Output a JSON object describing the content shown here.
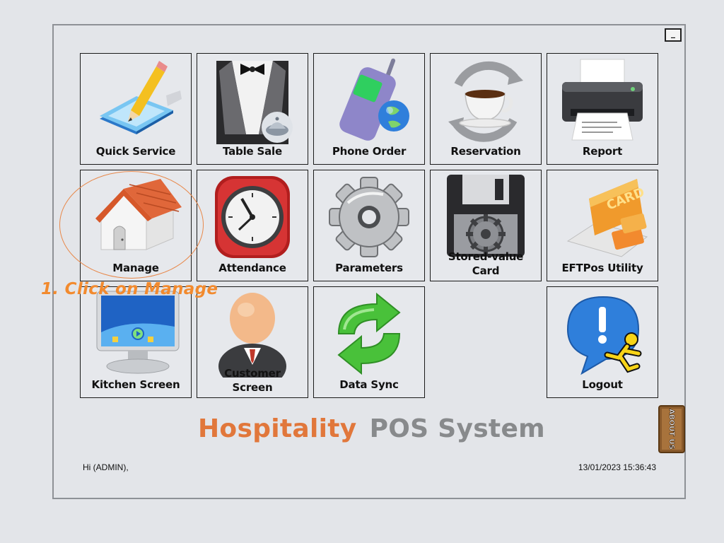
{
  "window": {
    "minimize_label": "_"
  },
  "tiles": [
    {
      "label": "Quick Service",
      "icon": "pencil-pad-icon"
    },
    {
      "label": "Table Sale",
      "icon": "waiter-tuxedo-icon"
    },
    {
      "label": "Phone Order",
      "icon": "mobile-phone-globe-icon"
    },
    {
      "label": "Reservation",
      "icon": "coffee-cup-cycle-icon"
    },
    {
      "label": "Report",
      "icon": "printer-icon"
    },
    {
      "label": "Manage",
      "icon": "house-icon"
    },
    {
      "label": "Attendance",
      "icon": "clock-icon"
    },
    {
      "label": "Parameters",
      "icon": "gear-icon"
    },
    {
      "label": "Stored-value Card",
      "line1": "Stored-value",
      "line2": "Card",
      "icon": "floppy-disk-icon"
    },
    {
      "label": "EFTPos Utility",
      "icon": "card-terminal-icon"
    },
    {
      "label": "Kitchen Screen",
      "icon": "monitor-icon"
    },
    {
      "label": "Customer Screen",
      "line1": "Customer",
      "line2": "Screen",
      "icon": "person-icon"
    },
    {
      "label": "Data Sync",
      "icon": "sync-arrows-icon"
    },
    {
      "label": "Logout",
      "icon": "logout-runner-icon"
    }
  ],
  "annotation": {
    "text": "1. Click on Manage",
    "color": "#f28a2e"
  },
  "brand": {
    "part1": "Hospitality",
    "part2": "POS System",
    "color1": "#e1773b",
    "color2": "#888a8c"
  },
  "about_button": {
    "label": "ABOUT US",
    "icon": "wooden-sign-icon"
  },
  "footer": {
    "greeting": "Hi (ADMIN),",
    "datetime": "13/01/2023 15:36:43"
  }
}
